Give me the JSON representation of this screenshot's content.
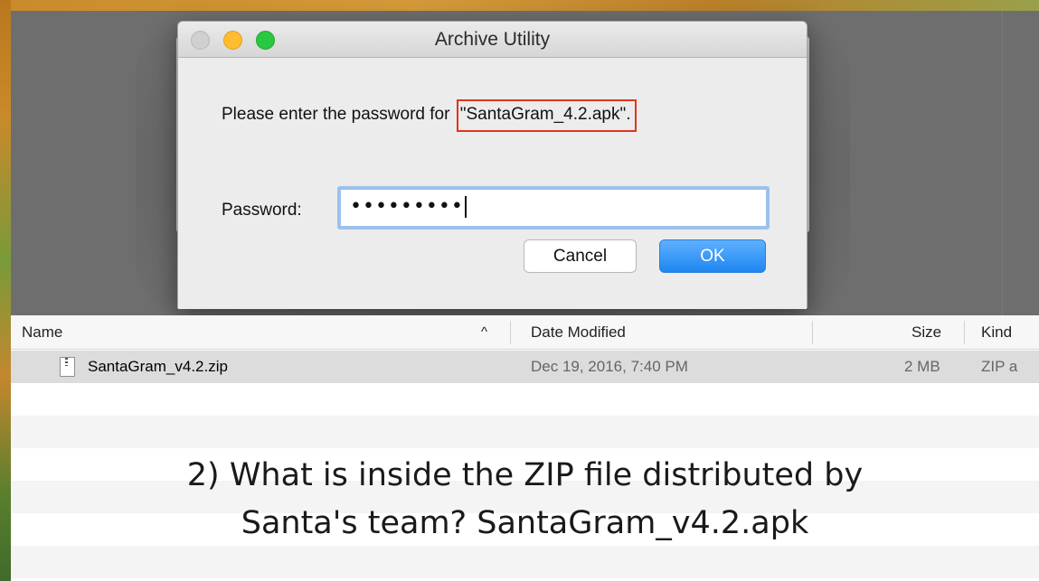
{
  "window": {
    "title": "Archive Utility"
  },
  "dialog": {
    "prompt_prefix": "Please enter the password for ",
    "filename": "\"SantaGram_4.2.apk\".",
    "password_label": "Password:",
    "password_value": "•••••••••",
    "cancel_label": "Cancel",
    "ok_label": "OK"
  },
  "list": {
    "columns": {
      "name": "Name",
      "sort_indicator": "^",
      "date": "Date Modified",
      "size": "Size",
      "kind": "Kind"
    },
    "rows": [
      {
        "name": "SantaGram_v4.2.zip",
        "date": "Dec 19, 2016, 7:40 PM",
        "size": "2 MB",
        "kind": "ZIP a"
      }
    ]
  },
  "caption": {
    "line1": "2) What is inside the ZIP file distributed by",
    "line2": "Santa's team? SantaGram_v4.2.apk"
  },
  "colors": {
    "highlight_border": "#e0341f",
    "ok_button": "#1e87f0",
    "focus_ring": "#9cc1ec"
  }
}
